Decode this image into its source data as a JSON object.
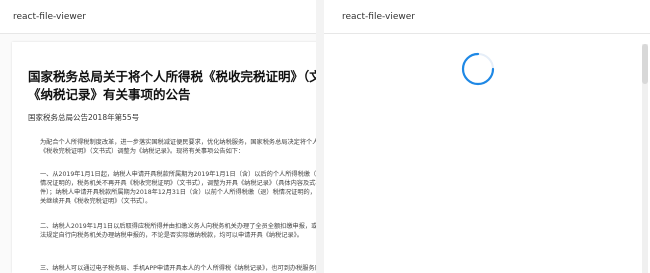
{
  "left_viewer": {
    "header_title": "react-file-viewer",
    "document": {
      "title_line1": "国家税务总局关于将个人所得税《税收完税证明》（文书式",
      "title_line2": "《纳税记录》有关事项的公告",
      "subtitle": "国家税务总局公告2018年第55号",
      "paragraphs": [
        [
          "为配合个人所得税制度改革，进一步落实国税减证便民要求，优化纳税服务，国家税务总局决定将个人所得税《税收完税证明》（文书式）调整为《纳税记录》。现将有关事项公告如下："
        ],
        [
          "一、从2019年1月1日起，纳税人申请开具税款所属期为2019年1月1日（含）以后的个人所得税缴（退）税情况证明的，税务机关不再开具《税收完税证明》（文书式），调整为开具《纳税记录》（具体内容及式样见附件）；纳税人申请开具税款所属期为2018年12月31日（含）以前个人所得税缴（退）税情况证明的，税务机关继续开具《税收完税证明》（文书式）。"
        ],
        [
          "二、纳税人2019年1月1日以后取得应税所得并由扣缴义务人向税务机关办理了全员全额扣缴申报，或根据税法规定自行向税务机关办理纳税申报的，不论是否实际缴纳税款，均可以申请开具《纳税记录》。"
        ],
        [
          "三、纳税人可以通过电子税务局、手机APP申请开具本人的个人所得税《纳税记录》，也可到办税服务厅申请开具。"
        ]
      ]
    }
  },
  "right_viewer": {
    "header_title": "react-file-viewer",
    "spinner_color": "#1e88e5"
  }
}
